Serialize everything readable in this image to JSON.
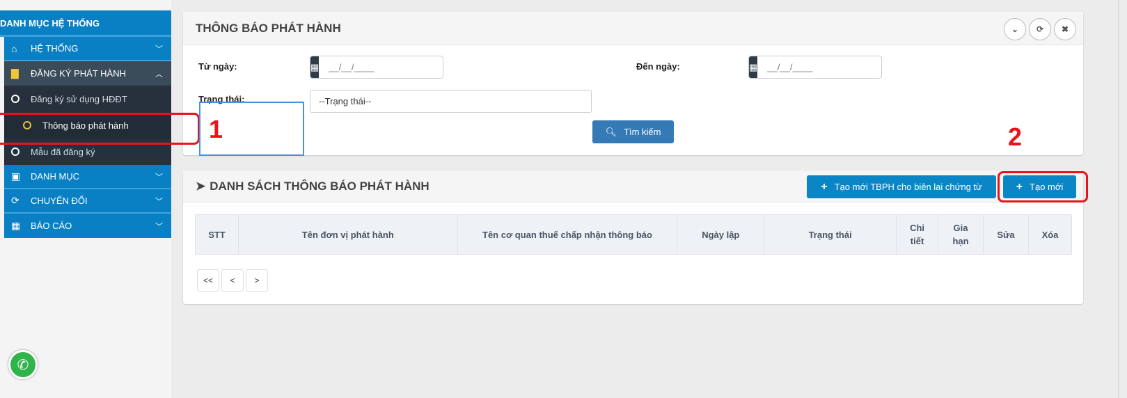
{
  "sidebar": {
    "title": "DANH MỤC HỆ THỐNG",
    "items": [
      {
        "label": "HỆ THỐNG",
        "icon": "home-icon"
      },
      {
        "label": "ĐĂNG KÝ PHÁT HÀNH",
        "icon": "file-icon"
      },
      {
        "label": "DANH MỤC",
        "icon": "save-icon"
      },
      {
        "label": "CHUYỂN ĐỔI",
        "icon": "refresh-icon"
      },
      {
        "label": "BÁO CÁO",
        "icon": "table-icon"
      }
    ],
    "subitems": [
      {
        "label": "Đăng ký sử dụng HĐĐT"
      },
      {
        "label": "Thông báo phát hành"
      },
      {
        "label": "Mẫu đã đăng ký"
      }
    ]
  },
  "search_panel": {
    "title": "THÔNG BÁO PHÁT HÀNH",
    "from_label": "Từ ngày:",
    "to_label": "Đến ngày:",
    "date_placeholder": "__/__/____",
    "status_label": "Trạng thái:",
    "status_value": "--Trạng thái--",
    "search_button": "Tìm kiếm"
  },
  "list_panel": {
    "title": "DANH SÁCH THÔNG BÁO PHÁT HÀNH",
    "create_receipt_button": "Tạo mới TBPH cho biên lai chứng từ",
    "create_button": "Tạo mới",
    "columns": [
      "STT",
      "Tên đơn vị phát hành",
      "Tên cơ quan thuế chấp nhận thông báo",
      "Ngày lập",
      "Trạng thái",
      "Chi tiết",
      "Gia hạn",
      "Sửa",
      "Xóa"
    ],
    "pager": [
      "<<",
      "<",
      ">"
    ]
  },
  "annotations": {
    "one": "1",
    "two": "2"
  },
  "colors": {
    "primary": "#0a86c6",
    "annotation": "#e8141a"
  }
}
